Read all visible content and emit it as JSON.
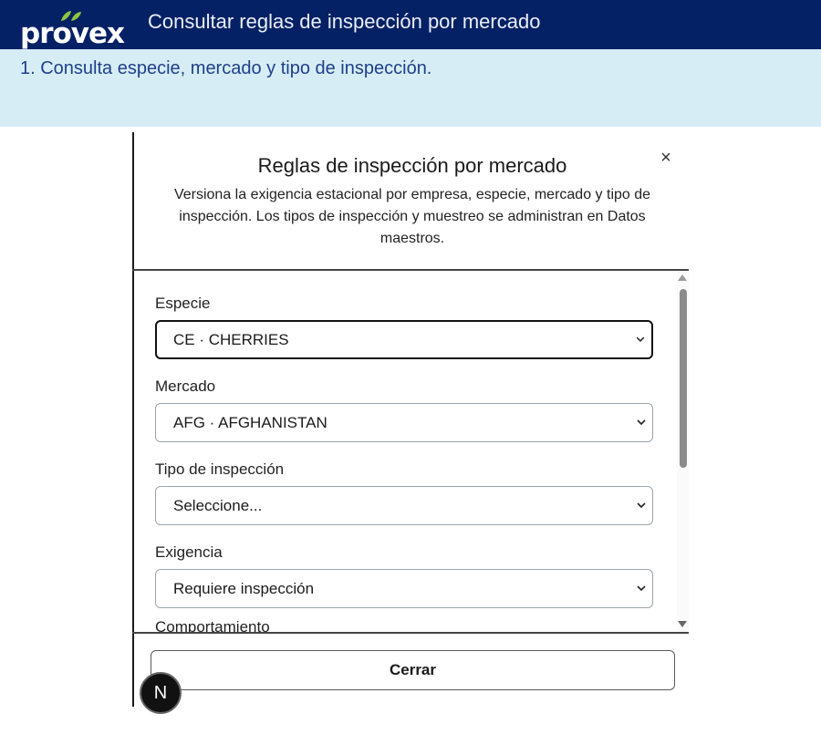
{
  "header": {
    "logo_text": "provex",
    "title": "Consultar reglas de inspección por mercado"
  },
  "banner": {
    "step": "1. Consulta especie, mercado y tipo de inspección."
  },
  "dialog": {
    "title": "Reglas de inspección por mercado",
    "close_icon": "×",
    "description": "Versiona la exigencia estacional por empresa, especie, mercado y tipo de inspección. Los tipos de inspección y muestreo se administran en Datos maestros.",
    "fields": [
      {
        "label": "Especie",
        "value": "CE · CHERRIES"
      },
      {
        "label": "Mercado",
        "value": "AFG · AFGHANISTAN"
      },
      {
        "label": "Tipo de inspección",
        "value": "Seleccione..."
      },
      {
        "label": "Exigencia",
        "value": "Requiere inspección"
      }
    ],
    "next_field_label": "Comportamiento",
    "close_button": "Cerrar"
  },
  "badge": {
    "label": "N"
  },
  "colors": {
    "topbar": "#052165",
    "banner": "#d6edf5",
    "logo_leaf": "#8cc63f"
  }
}
